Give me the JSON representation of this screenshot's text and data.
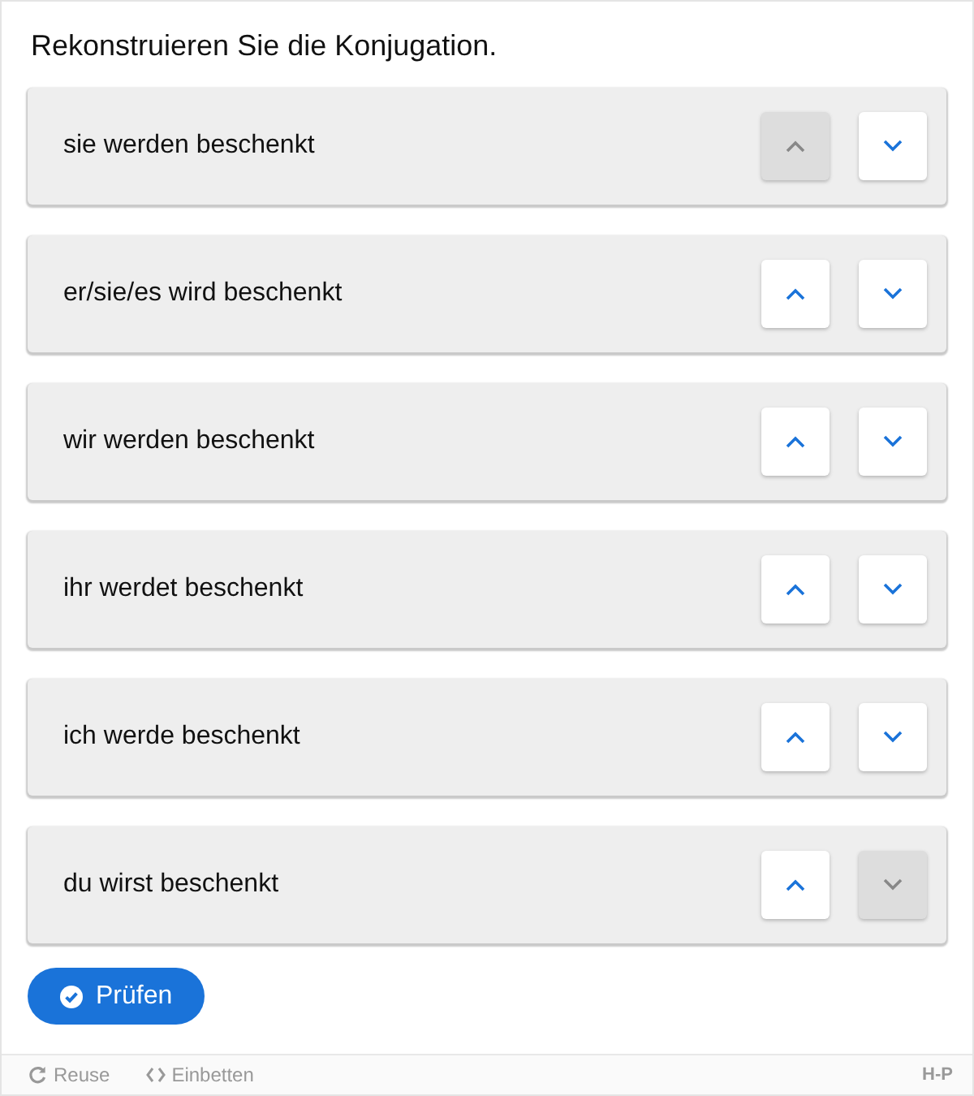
{
  "task": {
    "title": "Rekonstruieren Sie die Konjugation."
  },
  "items": [
    {
      "text": "sie werden beschenkt",
      "up_disabled": true,
      "down_disabled": false
    },
    {
      "text": "er/sie/es wird beschenkt",
      "up_disabled": false,
      "down_disabled": false
    },
    {
      "text": "wir werden beschenkt",
      "up_disabled": false,
      "down_disabled": false
    },
    {
      "text": "ihr werdet beschenkt",
      "up_disabled": false,
      "down_disabled": false
    },
    {
      "text": "ich werde beschenkt",
      "up_disabled": false,
      "down_disabled": false
    },
    {
      "text": "du wirst beschenkt",
      "up_disabled": false,
      "down_disabled": true
    }
  ],
  "check_button": {
    "label": "Prüfen"
  },
  "footer": {
    "links": [
      {
        "kind": "reuse",
        "label": "Reuse"
      },
      {
        "kind": "embed",
        "label": "Einbetten"
      }
    ],
    "logo": "H-P"
  }
}
